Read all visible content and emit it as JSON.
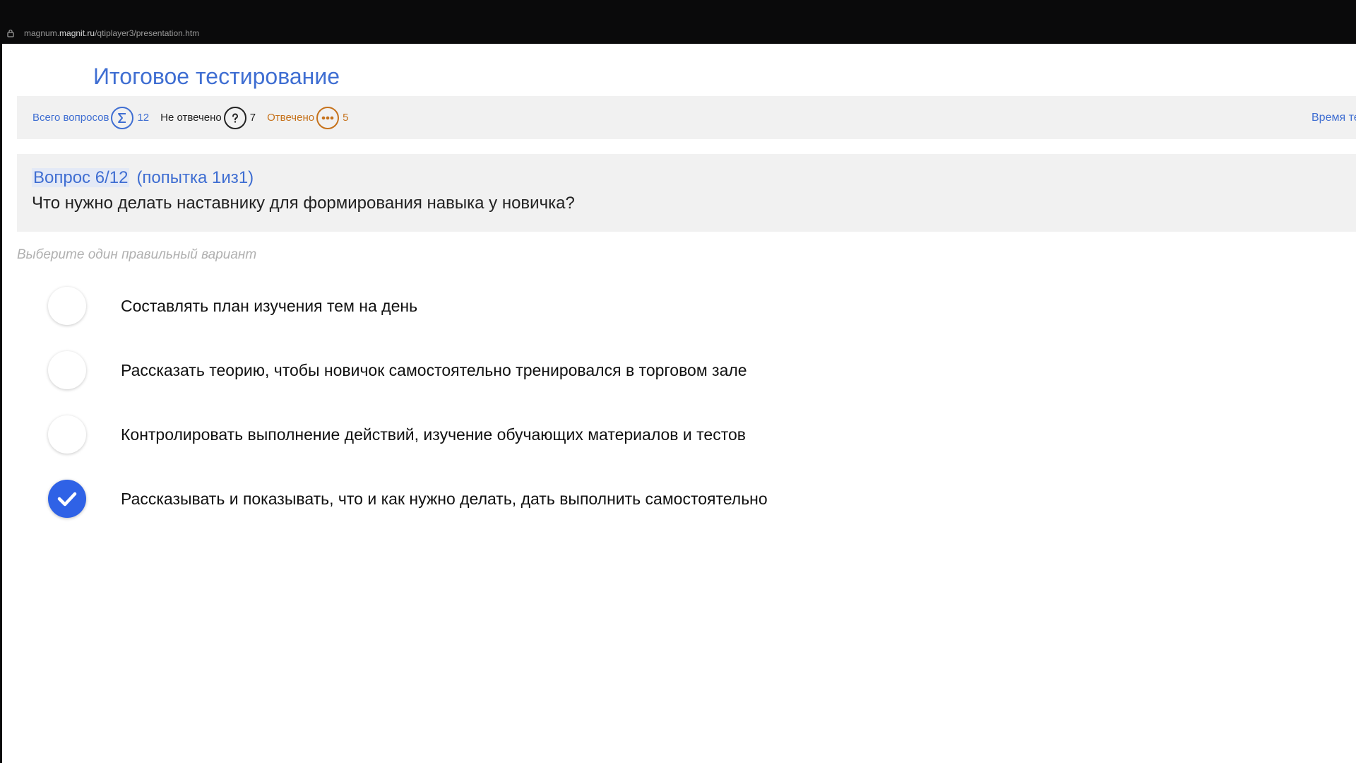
{
  "browser": {
    "url_prefix": "magnum.",
    "url_host": "magnit.ru",
    "url_path": "/qtiplayer3/presentation.htm"
  },
  "test": {
    "title": "Итоговое тестирование"
  },
  "stats": {
    "total_label": "Всего вопросов",
    "total_count": "12",
    "unanswered_label": "Не отвечено",
    "unanswered_count": "7",
    "answered_label": "Отвечено",
    "answered_count": "5",
    "time_label": "Время те"
  },
  "question": {
    "number": "Вопрос 6/12",
    "attempt": "(попытка 1из1)",
    "text": "Что нужно делать наставнику для формирования навыка у новичка?",
    "hint": "Выберите один правильный вариант"
  },
  "options": [
    {
      "text": "Составлять план изучения тем на день",
      "selected": false
    },
    {
      "text": "Рассказать теорию, чтобы новичок самостоятельно тренировался в торговом зале",
      "selected": false
    },
    {
      "text": "Контролировать выполнение действий, изучение обучающих материалов и тестов",
      "selected": false
    },
    {
      "text": "Рассказывать и показывать, что и как нужно делать, дать выполнить самостоятельно",
      "selected": true
    }
  ],
  "colors": {
    "accent": "#3f6ed2",
    "answered": "#c6721b",
    "selected_radio": "#2f62e6"
  },
  "icons": {
    "total": "sigma-icon",
    "unanswered": "question-mark-icon",
    "answered": "ellipsis-icon",
    "selected": "checkmark-icon",
    "secure": "lock-icon"
  }
}
